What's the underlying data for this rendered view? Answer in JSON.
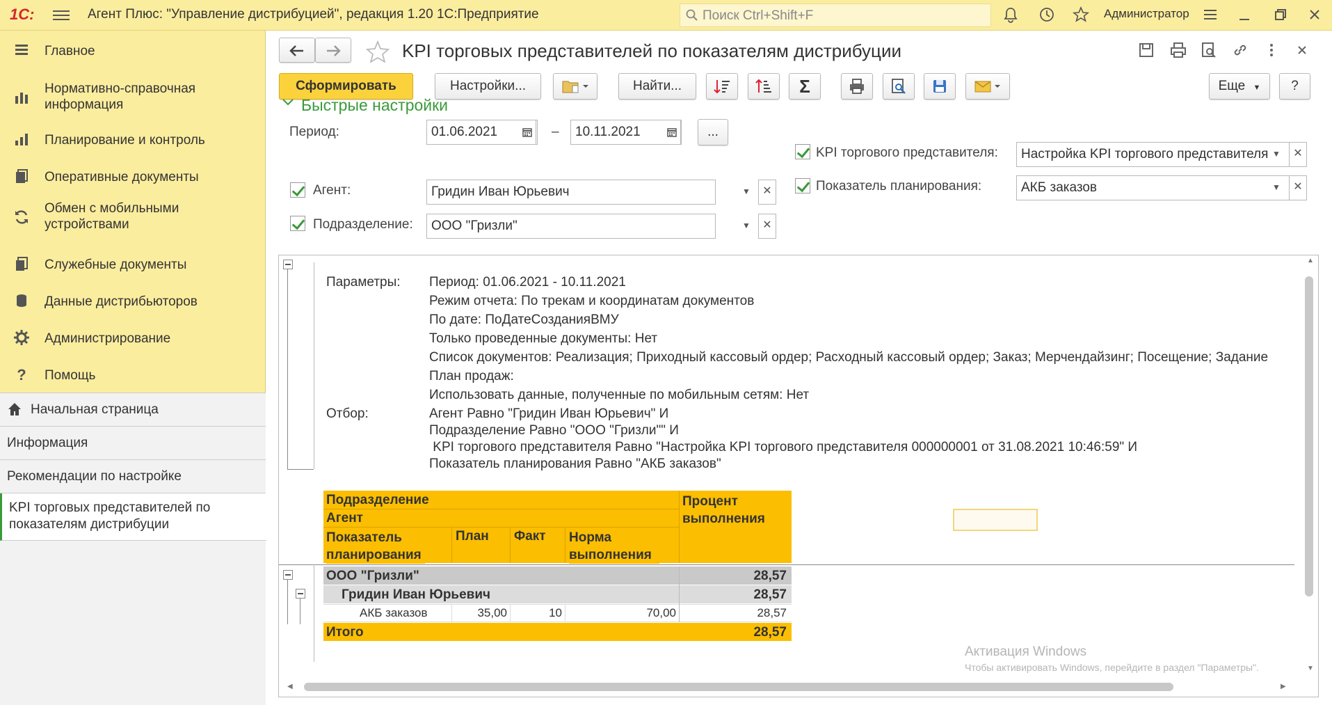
{
  "app": {
    "logo": "1С:",
    "title": "Агент Плюс: \"Управление дистрибуцией\", редакция 1.20 1С:Предприятие",
    "search_placeholder": "Поиск Ctrl+Shift+F",
    "user": "Администратор"
  },
  "sidebar": {
    "items": [
      {
        "label": "Главное",
        "icon": "menu-lines-icon"
      },
      {
        "label": "Нормативно-справочная информация",
        "icon": "bar-chart-icon"
      },
      {
        "label": "Планирование и контроль",
        "icon": "chart-icon"
      },
      {
        "label": "Оперативные документы",
        "icon": "documents-icon"
      },
      {
        "label": "Обмен с мобильными устройствами",
        "icon": "sync-icon"
      },
      {
        "label": "Служебные документы",
        "icon": "service-docs-icon"
      },
      {
        "label": "Данные дистрибьюторов",
        "icon": "database-icon"
      },
      {
        "label": "Администрирование",
        "icon": "gear-icon"
      },
      {
        "label": "Помощь",
        "icon": "help-icon"
      }
    ],
    "open_windows": [
      {
        "label": "Начальная страница"
      },
      {
        "label": "Информация"
      },
      {
        "label": "Рекомендации по настройке"
      },
      {
        "label": "KPI торговых представителей по показателям дистрибуции"
      }
    ]
  },
  "form": {
    "title": "KPI торговых представителей по показателям дистрибуции",
    "toolbar": {
      "generate": "Сформировать",
      "settings": "Настройки...",
      "find": "Найти...",
      "more": "Еще",
      "help": "?"
    },
    "quick_settings": "Быстрые настройки",
    "period_label": "Период:",
    "period_from": "01.06.2021",
    "period_dash": "–",
    "period_to": "10.11.2021",
    "period_more": "...",
    "agent_label": "Агент:",
    "agent_value": "Гридин Иван Юрьевич",
    "division_label": "Подразделение:",
    "division_value": "ООО \"Гризли\"",
    "kpi_label": "KPI торгового представителя:",
    "kpi_value": "Настройка KPI торгового представителя",
    "indicator_label": "Показатель планирования:",
    "indicator_value": "АКБ заказов"
  },
  "report": {
    "params_label": "Параметры:",
    "params": [
      "Период: 01.06.2021 - 10.11.2021",
      "Режим отчета: По трекам и координатам документов",
      "По дате: ПоДатеСозданияВМУ",
      "Только проведенные документы: Нет",
      "Список документов: Реализация; Приходный кассовый ордер; Расходный кассовый ордер; Заказ; Мерчендайзинг; Посещение; Задание",
      "План продаж:",
      "Использовать данные, полученные по мобильным сетям: Нет"
    ],
    "filter_label": "Отбор:",
    "filters": [
      "Агент Равно \"Гридин Иван Юрьевич\" И",
      "Подразделение Равно \"ООО \"Гризли\"\" И",
      " KPI торгового представителя Равно \"Настройка KPI торгового представителя 000000001 от 31.08.2021 10:46:59\" И",
      "Показатель планирования Равно \"АКБ заказов\""
    ],
    "headers": {
      "division": "Подразделение",
      "agent": "Агент",
      "indicator": "Показатель планирования",
      "plan": "План",
      "fact": "Факт",
      "norm": "Норма выполнения",
      "percent": "Процент выполнения"
    },
    "rows": {
      "division_name": "ООО \"Гризли\"",
      "division_percent": "28,57",
      "agent_name": "Гридин Иван Юрьевич",
      "agent_percent": "28,57",
      "detail_indicator": "АКБ заказов",
      "detail_plan": "35,00",
      "detail_fact": "10",
      "detail_norm": "70,00",
      "detail_percent": "28,57",
      "total_label": "Итого",
      "total_percent": "28,57"
    }
  },
  "watermark": {
    "title": "Активация Windows",
    "subtitle": "Чтобы активировать Windows, перейдите в раздел \"Параметры\"."
  },
  "colors": {
    "accent_yellow": "#fbed9e",
    "report_header": "#fbbe00",
    "button_primary": "#fbd23c",
    "check_green": "#3a9a3a"
  }
}
